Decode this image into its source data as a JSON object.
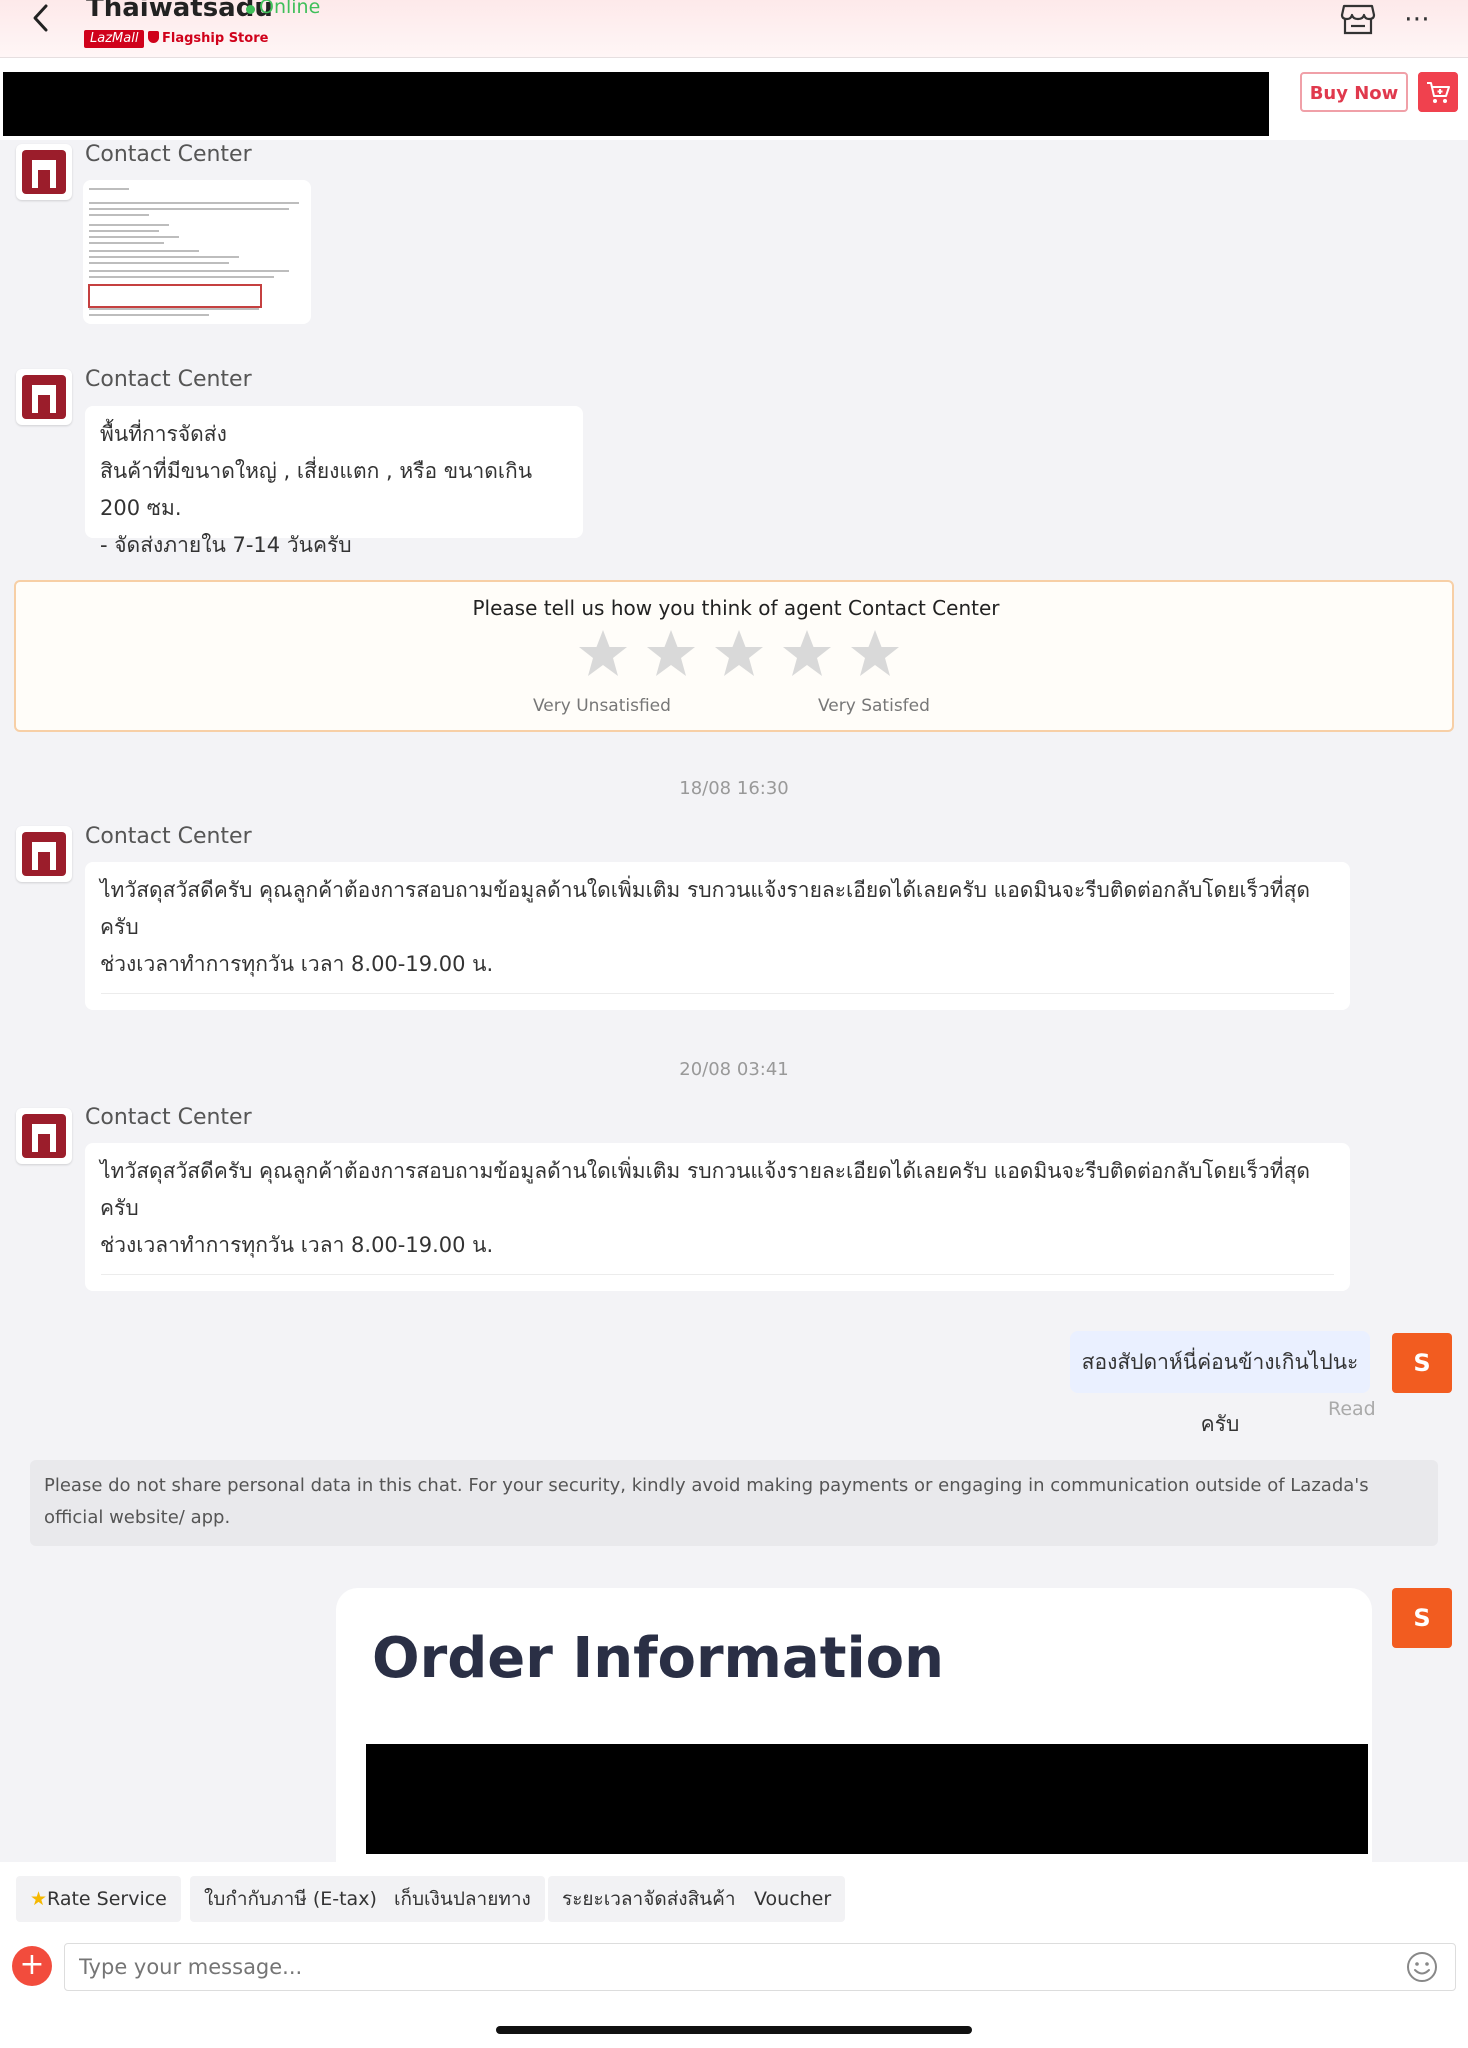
{
  "header": {
    "store_name": "Thaiwatsadu",
    "status": "Online",
    "badge": "LazMall",
    "store_type": "Flagship Store"
  },
  "product_bar": {
    "buy_now_label": "Buy Now"
  },
  "messages": [
    {
      "sender": "Contact Center"
    },
    {
      "sender": "Contact Center",
      "lines": [
        "พื้นที่การจัดส่ง",
        "สินค้าที่มีขนาดใหญ่ , เสี่ยงแตก , หรือ ขนาดเกิน 200 ซม.",
        "- จัดส่งภายใน 7-14 วันครับ"
      ]
    },
    {
      "timestamp": "18/08 16:30",
      "sender": "Contact Center",
      "lines": [
        "ไทวัสดุสวัสดีครับ คุณลูกค้าต้องการสอบถามข้อมูลด้านใดเพิ่มเติม รบกวนแจ้งรายละเอียดได้เลยครับ แอดมินจะรีบติดต่อกลับโดยเร็วที่สุดครับ",
        "ช่วงเวลาทำการทุกวัน เวลา 8.00-19.00 น."
      ]
    },
    {
      "timestamp": "20/08 03:41",
      "sender": "Contact Center",
      "lines": [
        "ไทวัสดุสวัสดีครับ คุณลูกค้าต้องการสอบถามข้อมูลด้านใดเพิ่มเติม รบกวนแจ้งรายละเอียดได้เลยครับ แอดมินจะรีบติดต่อกลับโดยเร็วที่สุดครับ",
        "ช่วงเวลาทำการทุกวัน เวลา 8.00-19.00 น."
      ]
    }
  ],
  "rating": {
    "prompt": "Please tell us how you think of agent Contact Center",
    "low_label": "Very Unsatisfied",
    "high_label": "Very Satisfed",
    "stars_selected": 0,
    "stars_total": 5
  },
  "my_message": {
    "avatar_letter": "S",
    "text": "สองสัปดาห์นี่ค่อนข้างเกินไปนะครับ",
    "status": "Read"
  },
  "notice": "Please do not share personal data in this chat. For your security, kindly avoid making payments or engaging in communication outside of Lazada's official website/ app.",
  "order_card": {
    "avatar_letter": "S",
    "title": "Order Information"
  },
  "quick_replies": [
    "Rate Service",
    "ใบกำกับภาษี (E-tax)",
    "เก็บเงินปลายทาง",
    "ระยะเวลาจัดส่งสินค้า",
    "Voucher"
  ],
  "composer": {
    "placeholder": "Type your message..."
  },
  "colors": {
    "accent": "#f25c20",
    "brand_red": "#d0021b",
    "online_green": "#3fbf5a"
  }
}
